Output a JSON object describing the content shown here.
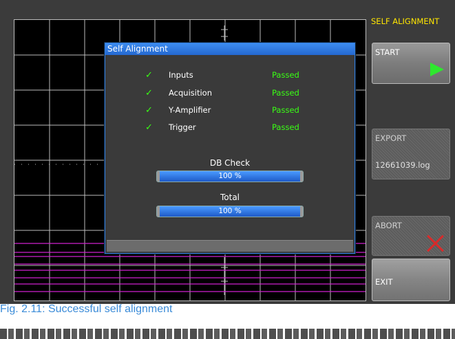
{
  "menu": {
    "title": "SELF ALIGNMENT",
    "start_label": "START",
    "export_label": "EXPORT",
    "export_file": "12661039.log",
    "abort_label": "ABORT",
    "exit_label": "EXIT"
  },
  "dialog": {
    "title": "Self Alignment",
    "checks": [
      {
        "name": "Inputs",
        "status": "Passed"
      },
      {
        "name": "Acquisition",
        "status": "Passed"
      },
      {
        "name": "Y-Amplifier",
        "status": "Passed"
      },
      {
        "name": "Trigger",
        "status": "Passed"
      }
    ],
    "db_check": {
      "label": "DB Check",
      "value_text": "100 %",
      "fraction": 1.0
    },
    "total": {
      "label": "Total",
      "value_text": "100 %",
      "fraction": 1.0
    }
  },
  "caption": "Fig. 2.11: Successful self alignment",
  "colors": {
    "accent_yellow": "#ffe600",
    "pass_green": "#39ff14",
    "dialog_blue": "#2f7de0",
    "trace_magenta": "#d020d0",
    "caption_blue": "#3a8bd8"
  }
}
